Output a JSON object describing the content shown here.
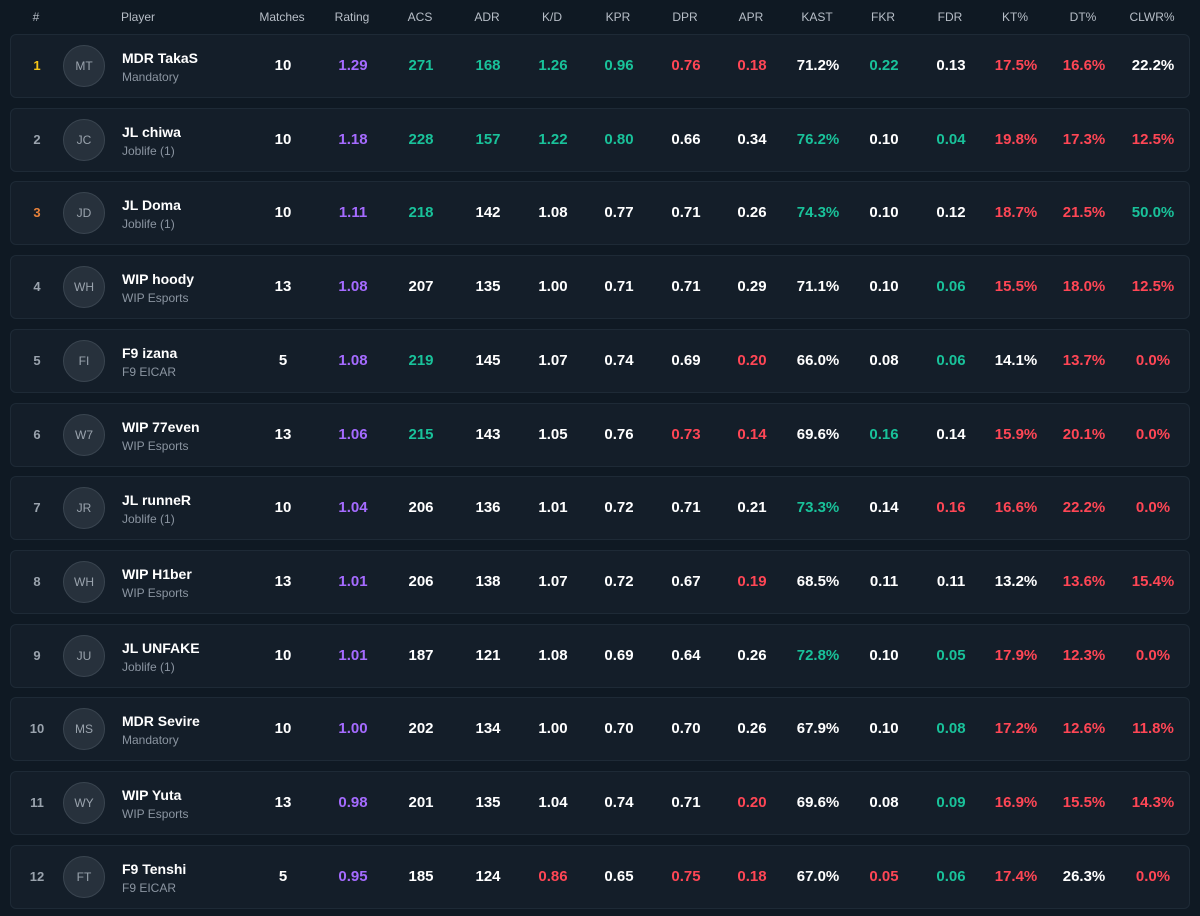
{
  "columns": [
    "#",
    "Player",
    "Matches",
    "Rating",
    "ACS",
    "ADR",
    "K/D",
    "KPR",
    "DPR",
    "APR",
    "KAST",
    "FKR",
    "FDR",
    "KT%",
    "DT%",
    "CLWR%"
  ],
  "colors": {
    "neutral": "#ffffff",
    "rating": "#a56bff",
    "good": "#19c29a",
    "bad": "#ff4655",
    "gold": "#f5c518",
    "bronze": "#e8823a"
  },
  "rows": [
    {
      "rank": "1",
      "initials": "MT",
      "name": "MDR TakaS",
      "team": "Mandatory",
      "stats": [
        "10",
        "1.29",
        "271",
        "168",
        "1.26",
        "0.96",
        "0.76",
        "0.18",
        "71.2%",
        "0.22",
        "0.13",
        "17.5%",
        "16.6%",
        "22.2%"
      ],
      "tones": [
        "w",
        "p",
        "g",
        "g",
        "g",
        "g",
        "r",
        "r",
        "w",
        "g",
        "w",
        "r",
        "r",
        "w"
      ]
    },
    {
      "rank": "2",
      "initials": "JC",
      "name": "JL chiwa",
      "team": "Joblife (1)",
      "stats": [
        "10",
        "1.18",
        "228",
        "157",
        "1.22",
        "0.80",
        "0.66",
        "0.34",
        "76.2%",
        "0.10",
        "0.04",
        "19.8%",
        "17.3%",
        "12.5%"
      ],
      "tones": [
        "w",
        "p",
        "g",
        "g",
        "g",
        "g",
        "w",
        "w",
        "g",
        "w",
        "g",
        "r",
        "r",
        "r"
      ]
    },
    {
      "rank": "3",
      "initials": "JD",
      "name": "JL Doma",
      "team": "Joblife (1)",
      "stats": [
        "10",
        "1.11",
        "218",
        "142",
        "1.08",
        "0.77",
        "0.71",
        "0.26",
        "74.3%",
        "0.10",
        "0.12",
        "18.7%",
        "21.5%",
        "50.0%"
      ],
      "tones": [
        "w",
        "p",
        "g",
        "w",
        "w",
        "w",
        "w",
        "w",
        "g",
        "w",
        "w",
        "r",
        "r",
        "g"
      ]
    },
    {
      "rank": "4",
      "initials": "WH",
      "name": "WIP hoody",
      "team": "WIP Esports",
      "stats": [
        "13",
        "1.08",
        "207",
        "135",
        "1.00",
        "0.71",
        "0.71",
        "0.29",
        "71.1%",
        "0.10",
        "0.06",
        "15.5%",
        "18.0%",
        "12.5%"
      ],
      "tones": [
        "w",
        "p",
        "w",
        "w",
        "w",
        "w",
        "w",
        "w",
        "w",
        "w",
        "g",
        "r",
        "r",
        "r"
      ]
    },
    {
      "rank": "5",
      "initials": "FI",
      "name": "F9 izana",
      "team": "F9 EICAR",
      "stats": [
        "5",
        "1.08",
        "219",
        "145",
        "1.07",
        "0.74",
        "0.69",
        "0.20",
        "66.0%",
        "0.08",
        "0.06",
        "14.1%",
        "13.7%",
        "0.0%"
      ],
      "tones": [
        "w",
        "p",
        "g",
        "w",
        "w",
        "w",
        "w",
        "r",
        "w",
        "w",
        "g",
        "w",
        "r",
        "r"
      ]
    },
    {
      "rank": "6",
      "initials": "W7",
      "name": "WIP 77even",
      "team": "WIP Esports",
      "stats": [
        "13",
        "1.06",
        "215",
        "143",
        "1.05",
        "0.76",
        "0.73",
        "0.14",
        "69.6%",
        "0.16",
        "0.14",
        "15.9%",
        "20.1%",
        "0.0%"
      ],
      "tones": [
        "w",
        "p",
        "g",
        "w",
        "w",
        "w",
        "r",
        "r",
        "w",
        "g",
        "w",
        "r",
        "r",
        "r"
      ]
    },
    {
      "rank": "7",
      "initials": "JR",
      "name": "JL runneR",
      "team": "Joblife (1)",
      "stats": [
        "10",
        "1.04",
        "206",
        "136",
        "1.01",
        "0.72",
        "0.71",
        "0.21",
        "73.3%",
        "0.14",
        "0.16",
        "16.6%",
        "22.2%",
        "0.0%"
      ],
      "tones": [
        "w",
        "p",
        "w",
        "w",
        "w",
        "w",
        "w",
        "w",
        "g",
        "w",
        "r",
        "r",
        "r",
        "r"
      ]
    },
    {
      "rank": "8",
      "initials": "WH",
      "name": "WIP H1ber",
      "team": "WIP Esports",
      "stats": [
        "13",
        "1.01",
        "206",
        "138",
        "1.07",
        "0.72",
        "0.67",
        "0.19",
        "68.5%",
        "0.11",
        "0.11",
        "13.2%",
        "13.6%",
        "15.4%"
      ],
      "tones": [
        "w",
        "p",
        "w",
        "w",
        "w",
        "w",
        "w",
        "r",
        "w",
        "w",
        "w",
        "w",
        "r",
        "r"
      ]
    },
    {
      "rank": "9",
      "initials": "JU",
      "name": "JL UNFAKE",
      "team": "Joblife (1)",
      "stats": [
        "10",
        "1.01",
        "187",
        "121",
        "1.08",
        "0.69",
        "0.64",
        "0.26",
        "72.8%",
        "0.10",
        "0.05",
        "17.9%",
        "12.3%",
        "0.0%"
      ],
      "tones": [
        "w",
        "p",
        "w",
        "w",
        "w",
        "w",
        "w",
        "w",
        "g",
        "w",
        "g",
        "r",
        "r",
        "r"
      ]
    },
    {
      "rank": "10",
      "initials": "MS",
      "name": "MDR Sevire",
      "team": "Mandatory",
      "stats": [
        "10",
        "1.00",
        "202",
        "134",
        "1.00",
        "0.70",
        "0.70",
        "0.26",
        "67.9%",
        "0.10",
        "0.08",
        "17.2%",
        "12.6%",
        "11.8%"
      ],
      "tones": [
        "w",
        "p",
        "w",
        "w",
        "w",
        "w",
        "w",
        "w",
        "w",
        "w",
        "g",
        "r",
        "r",
        "r"
      ]
    },
    {
      "rank": "11",
      "initials": "WY",
      "name": "WIP Yuta",
      "team": "WIP Esports",
      "stats": [
        "13",
        "0.98",
        "201",
        "135",
        "1.04",
        "0.74",
        "0.71",
        "0.20",
        "69.6%",
        "0.08",
        "0.09",
        "16.9%",
        "15.5%",
        "14.3%"
      ],
      "tones": [
        "w",
        "p",
        "w",
        "w",
        "w",
        "w",
        "w",
        "r",
        "w",
        "w",
        "g",
        "r",
        "r",
        "r"
      ]
    },
    {
      "rank": "12",
      "initials": "FT",
      "name": "F9 Tenshi",
      "team": "F9 EICAR",
      "stats": [
        "5",
        "0.95",
        "185",
        "124",
        "0.86",
        "0.65",
        "0.75",
        "0.18",
        "67.0%",
        "0.05",
        "0.06",
        "17.4%",
        "26.3%",
        "0.0%"
      ],
      "tones": [
        "w",
        "p",
        "w",
        "w",
        "r",
        "w",
        "r",
        "r",
        "w",
        "r",
        "g",
        "r",
        "w",
        "r"
      ]
    }
  ]
}
